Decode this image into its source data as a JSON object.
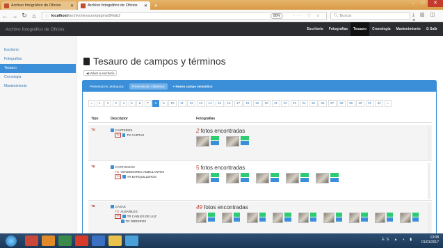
{
  "browser": {
    "tabs": [
      {
        "label": "Archivo fotográfico de Oficios",
        "active": false
      },
      {
        "label": "Archivo fotográfico de Oficios",
        "active": true
      }
    ],
    "new_tab": "+",
    "url_host": "localhost",
    "url_path": "/archivo/tesauro/pagina/8#tab2",
    "zoom": "80%",
    "search_placeholder": "Buscar"
  },
  "app": {
    "brand": "Archivo fotográfico de Oficios",
    "menu": [
      {
        "label": "Escritorio",
        "active": false
      },
      {
        "label": "Fotografías",
        "active": false
      },
      {
        "label": "Tesauro",
        "active": true
      },
      {
        "label": "Cronología",
        "active": false
      },
      {
        "label": "Mantenimiento",
        "active": false
      },
      {
        "label": "Salir",
        "active": false
      }
    ]
  },
  "sidebar": {
    "items": [
      {
        "label": "Escritorio",
        "active": false
      },
      {
        "label": "Fotografías",
        "active": false
      },
      {
        "label": "Tesauro",
        "active": true
      },
      {
        "label": "Cronología",
        "active": false
      },
      {
        "label": "Mantenimiento",
        "active": false
      }
    ]
  },
  "main": {
    "title": "Tesauro de campos y términos",
    "back_label": "Volver a escritorio",
    "tabs": [
      {
        "label": "Presentación Jerárquica",
        "active": false
      },
      {
        "label": "Presentación Alfabética",
        "active": true
      },
      {
        "label": "+ Nuevo campo semántico",
        "active": false
      }
    ],
    "pager": {
      "prev": "«",
      "next": "»",
      "pages": [
        "1",
        "2",
        "3",
        "4",
        "5",
        "6",
        "7",
        "8",
        "9",
        "10",
        "11",
        "12",
        "13",
        "14",
        "15",
        "16",
        "17",
        "18",
        "19",
        "20",
        "21",
        "22",
        "23",
        "24",
        "25",
        "26",
        "27",
        "28",
        "29",
        "30",
        "31",
        "32"
      ],
      "active": "8"
    },
    "table": {
      "headers": [
        "Tipo",
        "Descriptor",
        "Fotografías"
      ],
      "rows": [
        {
          "type": "TG",
          "descriptor": "CARTEROS",
          "relations": [
            {
              "rel": "TE",
              "term": "TE CARTAS",
              "boxed": true
            }
          ],
          "count": "2",
          "count_text": "fotos encontradas",
          "italic": true,
          "thumbs": 2
        },
        {
          "type": "TE",
          "descriptor": "CARTUCHOS",
          "relations": [
            {
              "rel": "TG",
              "term": "VENDEDORES AMBULANTES",
              "boxed": false
            },
            {
              "rel": "TR",
              "term": "TR BARQUILLEROS",
              "boxed": true
            }
          ],
          "count": "5",
          "count_text": "fotos encontradas",
          "italic": false,
          "thumbs": 5
        },
        {
          "type": "TE",
          "descriptor": "CASAS",
          "relations": [
            {
              "rel": "TG",
              "term": "ALBAÑILES",
              "boxed": false
            },
            {
              "rel": "TR",
              "term": "TR CABLES DE LUZ",
              "boxed": true
            },
            {
              "rel": "",
              "term": "TR OBREROS",
              "boxed": false
            }
          ],
          "count": "49",
          "count_text": "fotos encontradas",
          "italic": true,
          "thumbs": 9
        }
      ]
    }
  },
  "taskbar": {
    "lang": "ES",
    "time": "13:08",
    "date": "01/01/2017"
  },
  "colors": {
    "accent": "#3a8fd8",
    "appbar": "#2b2d30",
    "photo_green": "#2ecc71",
    "relation_red": "#c0392b"
  }
}
